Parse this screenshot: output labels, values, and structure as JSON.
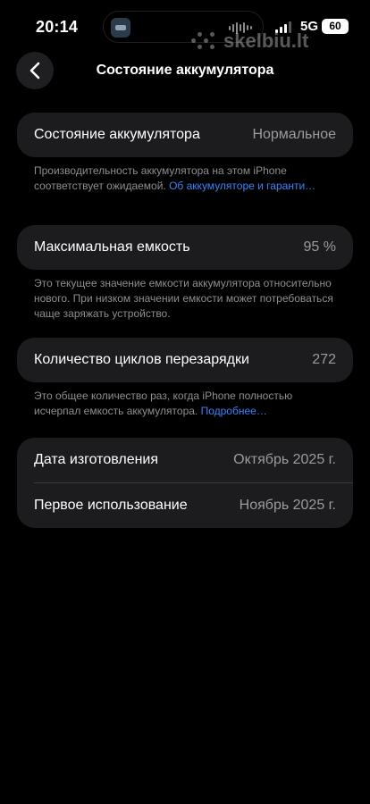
{
  "status_bar": {
    "time": "20:14",
    "network": "5G",
    "battery": "60",
    "watermark": "skelbiu.lt"
  },
  "nav": {
    "back_icon": "chevron-left-icon",
    "title": "Состояние аккумулятора"
  },
  "sections": [
    {
      "label": "Состояние аккумулятора",
      "value": "Нормальное",
      "footnote": "Производительность аккумулятора на этом iPhone соответствует ожидаемой. ",
      "footnote_link": "Об аккумуляторе и гаранти…"
    },
    {
      "label": "Максимальная емкость",
      "value": "95 %",
      "footnote": "Это текущее значение емкости аккумулятора относительно нового. При низком значении емкости может потребоваться чаще заряжать устройство."
    },
    {
      "label": "Количество циклов перезарядки",
      "value": "272",
      "footnote": "Это общее количество раз, когда iPhone полностью исчерпал емкость аккумулятора. ",
      "footnote_link": "Подробнее…"
    }
  ],
  "dates": [
    {
      "label": "Дата изготовления",
      "value": "Октябрь 2025 г."
    },
    {
      "label": "Первое использование",
      "value": "Ноябрь 2025 г."
    }
  ],
  "colors": {
    "background": "#000000",
    "card": "#1c1c1e",
    "link": "#3b82f6",
    "secondary_text": "#8e8e93"
  }
}
